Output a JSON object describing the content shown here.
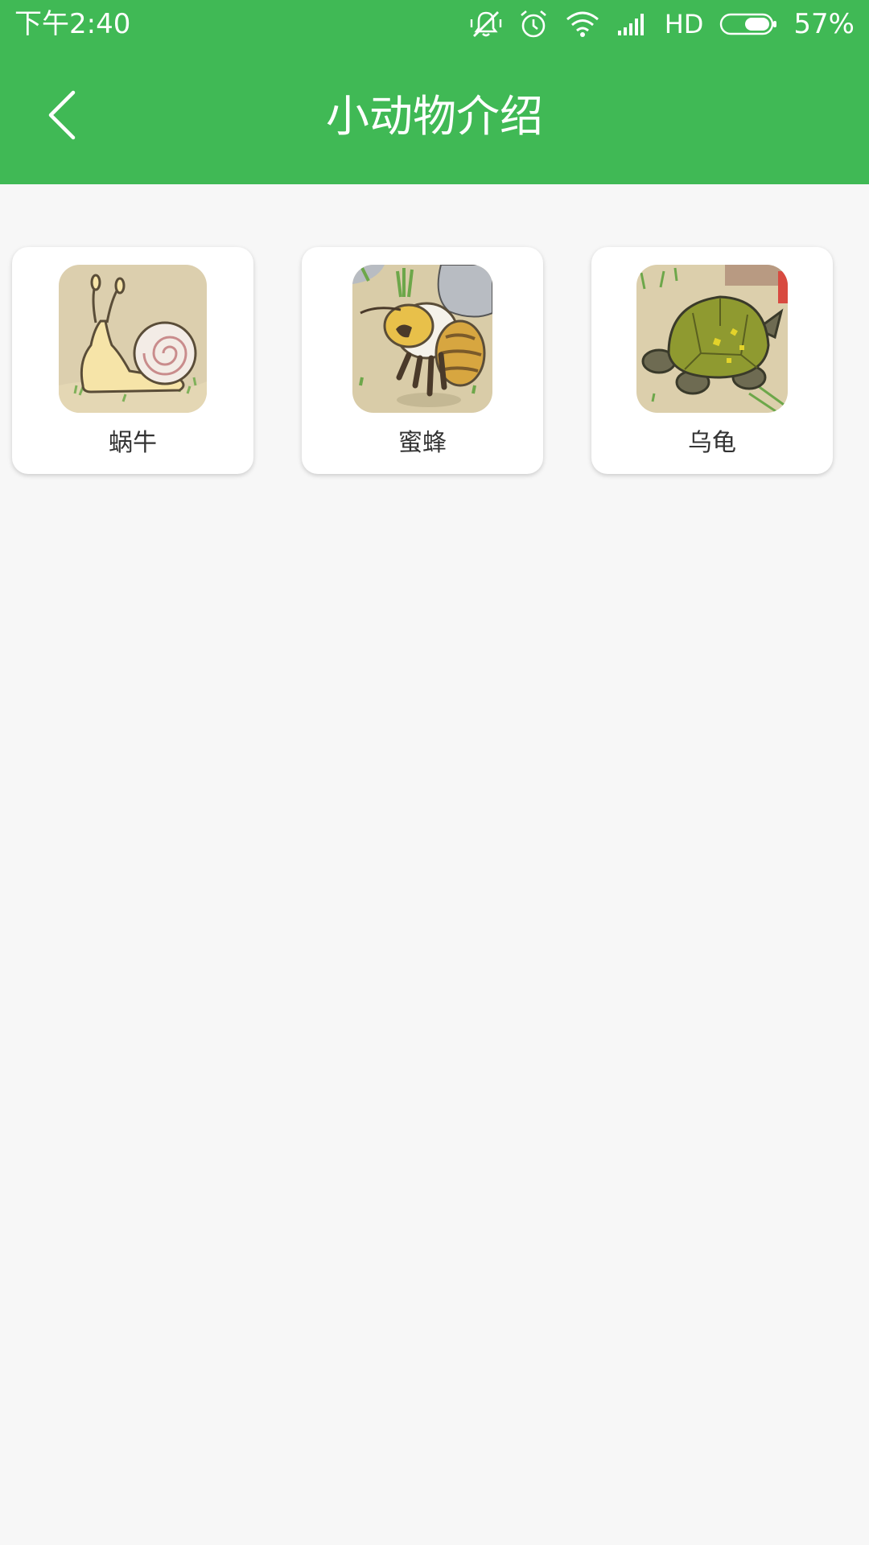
{
  "status_bar": {
    "time": "下午2:40",
    "network": "HD",
    "battery": "57%"
  },
  "app_bar": {
    "title": "小动物介绍",
    "back_icon": "chevron-left-icon"
  },
  "colors": {
    "primary": "#40b955",
    "background": "#f7f7f7",
    "card": "#ffffff",
    "label": "#333333"
  },
  "animals": [
    {
      "name": "蜗牛",
      "image": "snail-illustration"
    },
    {
      "name": "蜜蜂",
      "image": "bee-illustration"
    },
    {
      "name": "乌龟",
      "image": "turtle-illustration"
    }
  ]
}
